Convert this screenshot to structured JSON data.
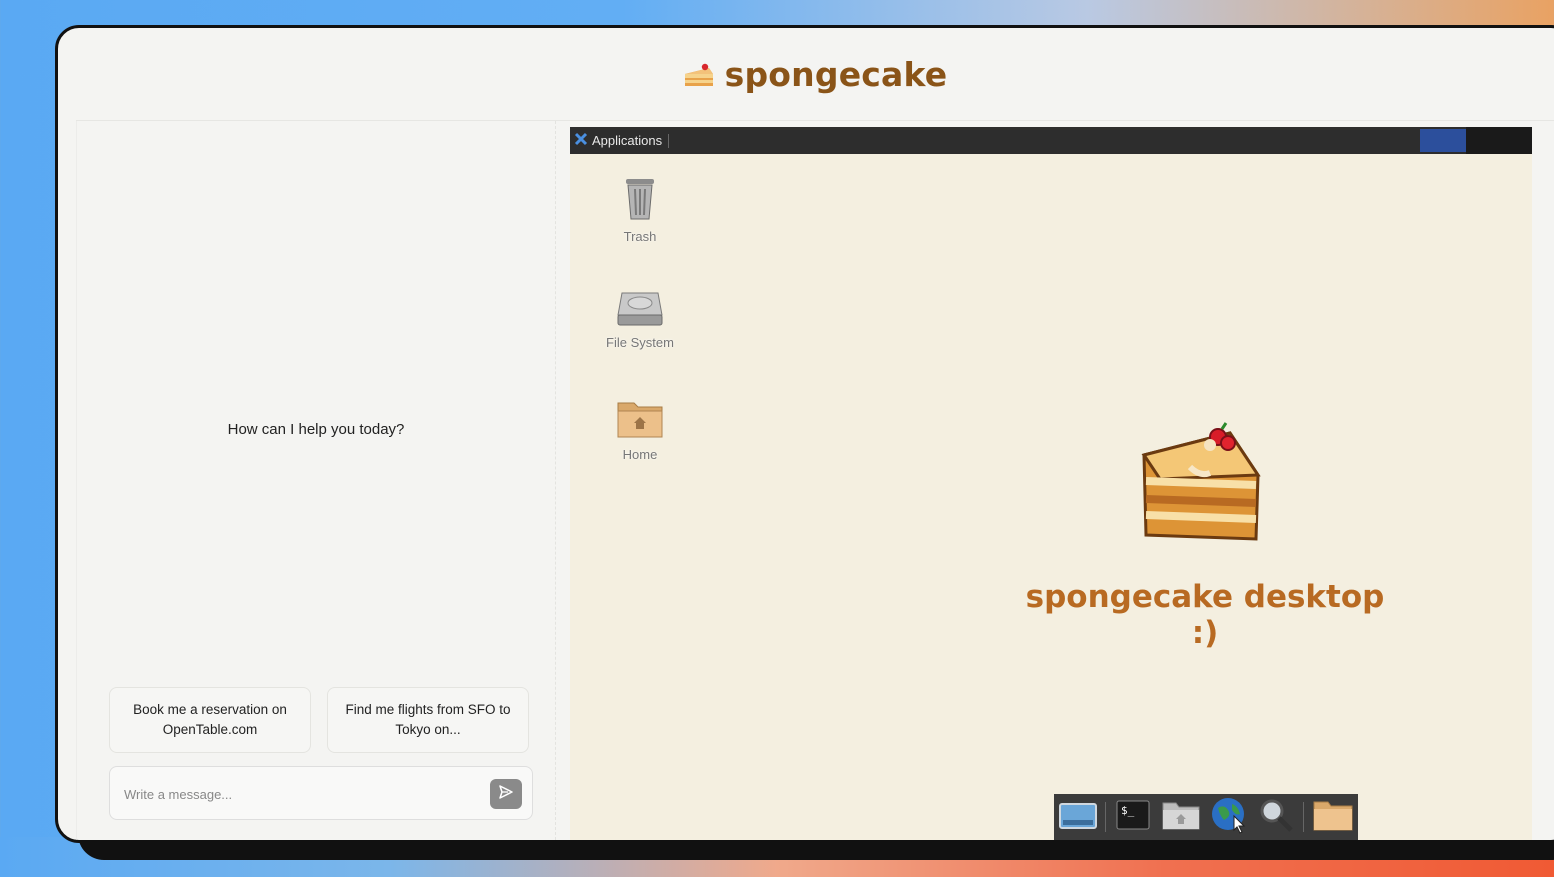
{
  "app": {
    "title": "spongecake"
  },
  "chat": {
    "welcome": "How can I help you today?",
    "suggestions": [
      {
        "label": "Book me a reservation on OpenTable.com"
      },
      {
        "label": "Find me flights from SFO to Tokyo on..."
      }
    ],
    "input": {
      "placeholder": "Write a message...",
      "value": ""
    },
    "send_icon": "send-icon"
  },
  "desktop": {
    "panel": {
      "menu_label": "Applications"
    },
    "icons": [
      {
        "label": "Trash",
        "icon": "trash-icon"
      },
      {
        "label": "File System",
        "icon": "hard-drive-icon"
      },
      {
        "label": "Home",
        "icon": "home-folder-icon"
      }
    ],
    "title": "spongecake desktop :)",
    "dock": [
      "show-desktop-icon",
      "terminal-icon",
      "file-manager-icon",
      "web-browser-icon",
      "search-icon",
      "folder-icon"
    ]
  },
  "colors": {
    "brand": "#8a5418",
    "desktop_title": "#b86a22",
    "desktop_bg": "#f4efe0",
    "panel": "#2d2d2d"
  }
}
